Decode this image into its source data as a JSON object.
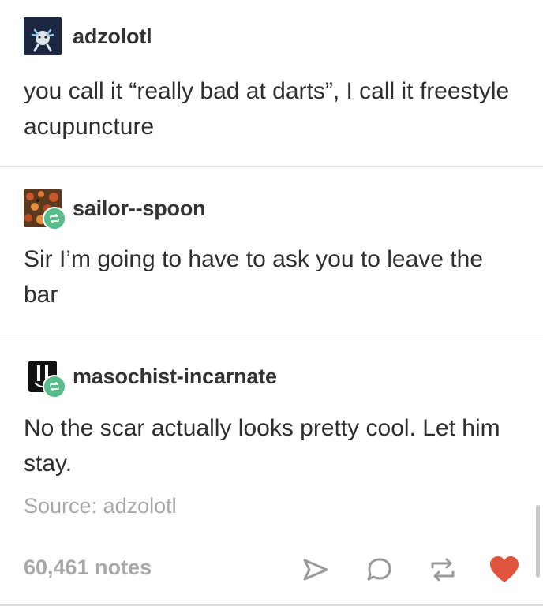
{
  "posts": [
    {
      "username": "adzolotl",
      "text": "you call it “really bad at darts”, I call it freestyle acupuncture",
      "avatar_icon": "axolotl-avatar",
      "reblog": false
    },
    {
      "username": "sailor--spoon",
      "text": "Sir I’m going to have to ask you to leave the bar",
      "avatar_icon": "pattern-avatar",
      "reblog": true
    },
    {
      "username": "masochist-incarnate",
      "text": "No the scar actually looks pretty cool. Let him stay.",
      "avatar_icon": "smiley-avatar",
      "reblog": true
    }
  ],
  "footer": {
    "source_label": "Source:",
    "source_name": "adzolotl",
    "notes": "60,461 notes"
  },
  "colors": {
    "reblog_green": "#56bc8a",
    "heart_red": "#e0533d",
    "muted_text": "#a8a8a8"
  },
  "actions": [
    "share-icon",
    "reply-icon",
    "reblog-icon",
    "like-heart-icon"
  ]
}
